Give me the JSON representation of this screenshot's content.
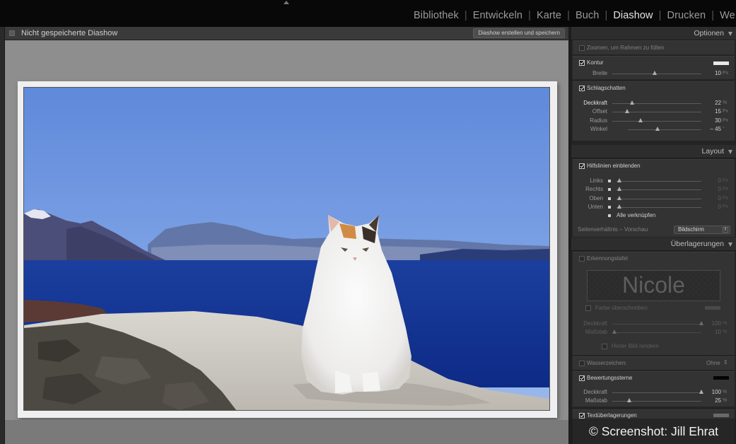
{
  "modules": [
    {
      "label": "Bibliothek",
      "active": false
    },
    {
      "label": "Entwickeln",
      "active": false
    },
    {
      "label": "Karte",
      "active": false
    },
    {
      "label": "Buch",
      "active": false
    },
    {
      "label": "Diashow",
      "active": true
    },
    {
      "label": "Drucken",
      "active": false
    },
    {
      "label": "We",
      "active": false
    }
  ],
  "center": {
    "title": "Nicht gespeicherte Diashow",
    "save_button": "Diashow erstellen und speichern"
  },
  "panel": {
    "optionen": {
      "header": "Optionen",
      "zoom_label": "Zoomen, um Rahmen zu füllen",
      "kontur_label": "Kontur",
      "breite_label": "Breite",
      "breite_value": "10",
      "breite_unit": "Px",
      "schlagschatten_label": "Schlagschatten",
      "deckkraft_label": "Deckkraft",
      "deckkraft_value": "22",
      "deckkraft_unit": "%",
      "offset_label": "Offset",
      "offset_value": "15",
      "offset_unit": "Px",
      "radius_label": "Radius",
      "radius_value": "30",
      "radius_unit": "Px",
      "winkel_label": "Winkel",
      "winkel_value": "– 45",
      "winkel_unit": "°"
    },
    "layout": {
      "header": "Layout",
      "hilfslinien_label": "Hilfslinien einblenden",
      "links_label": "Links",
      "rechts_label": "Rechts",
      "oben_label": "Oben",
      "unten_label": "Unten",
      "margin_value": "0",
      "margin_unit": "Px",
      "alle_label": "Alle verknüpfen",
      "seiten_label": "Seitenverhältnis – Vorschau",
      "seiten_value": "Bildschirm"
    },
    "ueberlagerungen": {
      "header": "Überlagerungen",
      "erkennung_label": "Erkennungstafel",
      "plate_text": "Nicole",
      "farbe_label": "Farbe überschreiben",
      "deckkraft_label": "Deckkraft",
      "deckkraft_value": "100",
      "deckkraft_unit": "%",
      "massstab_label": "Maßstab",
      "massstab_value": "10",
      "massstab_unit": "%",
      "hinter_label": "Hinter Bild rendern",
      "wasser_label": "Wasserzeichen:",
      "wasser_value": "Ohne",
      "sterne_label": "Bewertungssterne",
      "sterne_deckkraft_label": "Deckkraft",
      "sterne_deckkraft_value": "100",
      "sterne_deckkraft_unit": "%",
      "sterne_massstab_label": "Maßstab",
      "sterne_massstab_value": "25",
      "sterne_massstab_unit": "%",
      "text_label": "Textüberlagerungen"
    }
  },
  "sliders": {
    "breite": 0.48,
    "deckkraft": 0.22,
    "offset": 0.17,
    "radius": 0.32,
    "winkel": 0.4,
    "margin": 0.0,
    "plate_deckkraft": 1.0,
    "plate_massstab": 0.02,
    "sterne_deckkraft": 1.0,
    "sterne_massstab": 0.19
  },
  "colors": {
    "kontur_swatch": "#e8e8e8",
    "farbe_swatch": "#4a4a4a",
    "sterne_swatch": "#050505",
    "text_swatch": "#6a6a6a"
  },
  "copyright": "© Screenshot: Jill Ehrat"
}
